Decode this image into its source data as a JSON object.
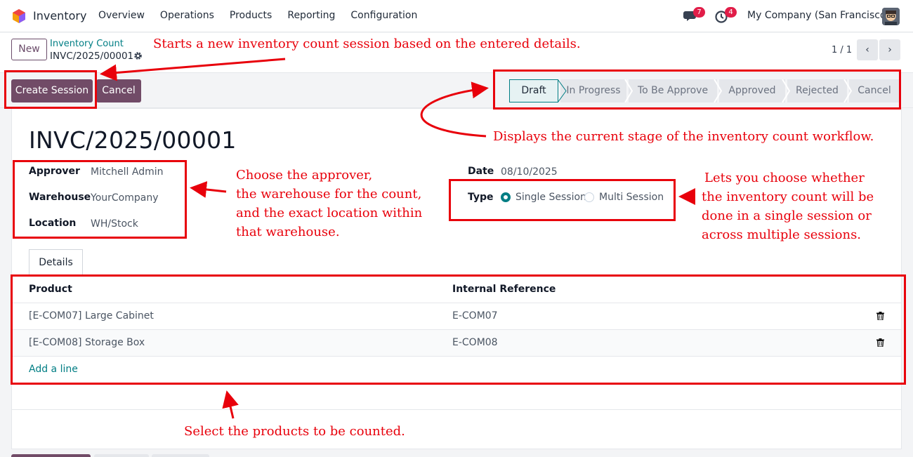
{
  "navbar": {
    "app_name": "Inventory",
    "menu": [
      "Overview",
      "Operations",
      "Products",
      "Reporting",
      "Configuration"
    ],
    "messages_badge": "7",
    "activity_badge": "4",
    "company": "My Company (San Francisco)"
  },
  "control_panel": {
    "new_label": "New",
    "breadcrumb_parent": "Inventory Count",
    "breadcrumb_current": "INVC/2025/00001",
    "pager": "1 / 1"
  },
  "statusbar": {
    "create_session_label": "Create Session",
    "cancel_label": "Cancel",
    "stages": [
      "Draft",
      "In Progress",
      "To Be Approve",
      "Approved",
      "Rejected",
      "Cancel"
    ],
    "current_stage": "Draft"
  },
  "form": {
    "title": "INVC/2025/00001",
    "approver_label": "Approver",
    "approver_value": "Mitchell Admin",
    "warehouse_label": "Warehouse",
    "warehouse_value": "YourCompany",
    "location_label": "Location",
    "location_value": "WH/Stock",
    "date_label": "Date",
    "date_value": "08/10/2025",
    "type_label": "Type",
    "type_options": [
      "Single Session",
      "Multi Session"
    ],
    "type_selected": "Single Session"
  },
  "details": {
    "tab_label": "Details",
    "columns": [
      "Product",
      "Internal Reference"
    ],
    "rows": [
      {
        "product": "[E-COM07] Large Cabinet",
        "ref": "E-COM07"
      },
      {
        "product": "[E-COM08] Storage Box",
        "ref": "E-COM08"
      }
    ],
    "add_line": "Add a line"
  },
  "annotations": {
    "create_session_note": "Starts a new inventory count session based on the entered details.",
    "stages_note": "Displays the current stage of the inventory count workflow.",
    "fields_note": [
      "Choose the approver,",
      "the warehouse for the count,",
      "and the exact location within",
      "that warehouse."
    ],
    "type_note": [
      "Lets you choose whether",
      "the inventory count will be",
      "done in a single session or",
      "across multiple sessions."
    ],
    "products_note": "Select the products to be counted.",
    "annotation_color": "#e8000b"
  },
  "colors": {
    "brand": "#714b67",
    "accent": "#017e84",
    "badge": "#e11d48"
  }
}
